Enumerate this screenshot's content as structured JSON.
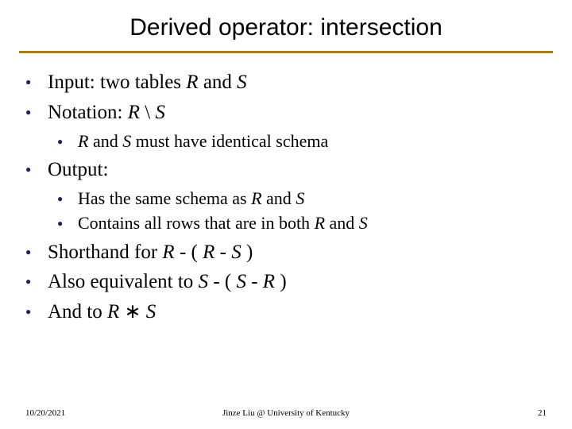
{
  "title": "Derived operator: intersection",
  "bullets": {
    "b1_pre": "Input: two tables ",
    "b1_R": "R",
    "b1_mid": " and ",
    "b1_S": "S",
    "b2_pre": "Notation: ",
    "b2_R": "R",
    "b2_op": " \\ ",
    "b2_S": "S",
    "b2s1_R": "R",
    "b2s1_mid": " and ",
    "b2s1_S": "S",
    "b2s1_post": " must have identical schema",
    "b3": "Output:",
    "b3s1_pre": "Has the same schema as ",
    "b3s1_R": "R",
    "b3s1_mid": " and ",
    "b3s1_S": "S",
    "b3s2_pre": "Contains all rows that are in both ",
    "b3s2_R": "R",
    "b3s2_mid": " and ",
    "b3s2_S": "S",
    "b4_pre": "Shorthand for ",
    "b4_R1": "R",
    "b4_m1": " - ( ",
    "b4_R2": "R",
    "b4_m2": " - ",
    "b4_S": "S",
    "b4_end": " )",
    "b5_pre": "Also equivalent to ",
    "b5_S1": "S",
    "b5_m1": " - ( ",
    "b5_S2": "S",
    "b5_m2": " - ",
    "b5_R": "R ",
    "b5_end": " )",
    "b6_pre": "And to ",
    "b6_R": "R",
    "b6_op": " ∗ ",
    "b6_S": "S"
  },
  "footer": {
    "date": "10/20/2021",
    "center": "Jinze Liu @ University of Kentucky",
    "page": "21"
  }
}
